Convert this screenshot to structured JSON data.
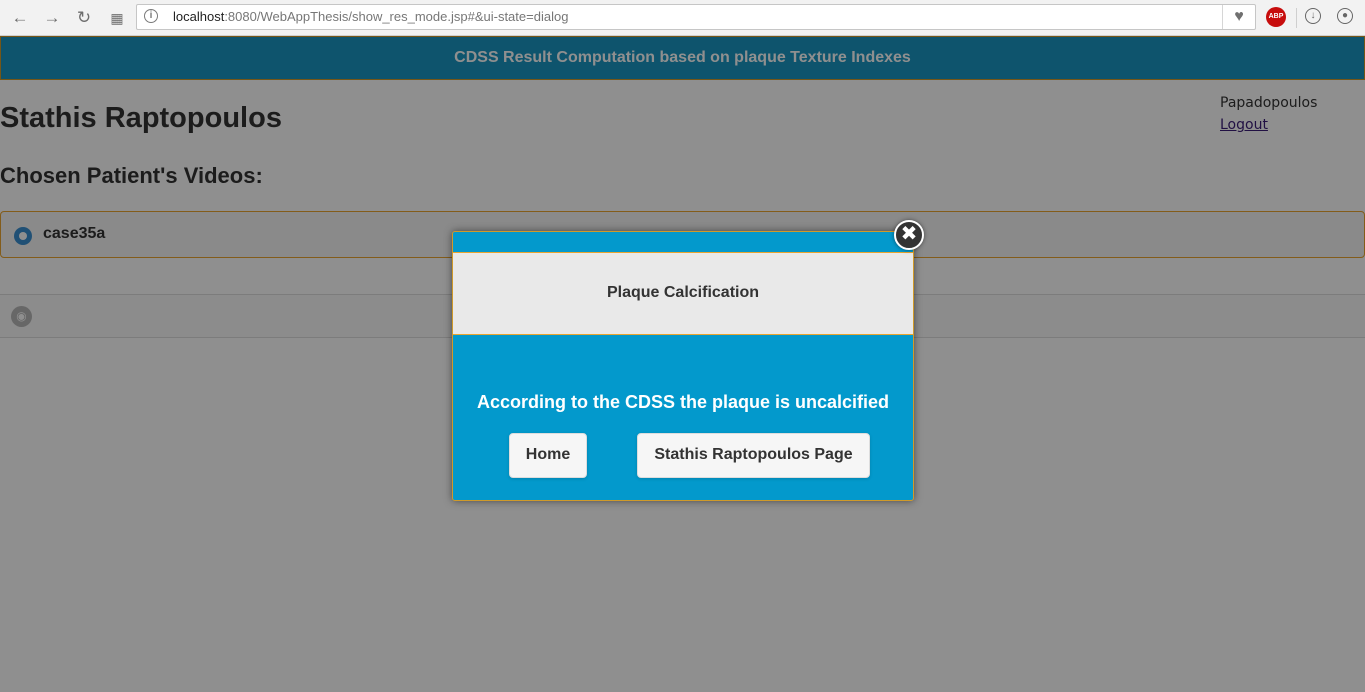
{
  "browser": {
    "url_host": "localhost",
    "url_rest": ":8080/WebAppThesis/show_res_mode.jsp#&ui-state=dialog",
    "abp_label": "ABP",
    "icons": [
      "back-arrow-icon",
      "forward-arrow-icon",
      "reload-icon",
      "apps-grid-icon",
      "page-info-icon",
      "heart-icon",
      "adblock-icon",
      "download-icon",
      "profile-icon"
    ]
  },
  "header": {
    "title": "CDSS Result Computation based on plaque Texture Indexes"
  },
  "user": {
    "name": "Papadopoulos",
    "logout_label": "Logout"
  },
  "patient": {
    "name": "Stathis Raptopoulos"
  },
  "videos": {
    "title": "Chosen Patient's Videos:",
    "items": [
      {
        "label": "case35a",
        "selected": true
      }
    ]
  },
  "dialog": {
    "title": "Plaque Calcification",
    "message": "According to the CDSS the plaque is uncalcified",
    "home_label": "Home",
    "patient_page_label": "Stathis Raptopoulos Page",
    "close_glyph": "✖"
  },
  "colors": {
    "header_bg": "#1a97c2",
    "dialog_bg": "#0399cc",
    "border_accent": "#e9a52f",
    "radio_blue": "#3a8fd0"
  }
}
